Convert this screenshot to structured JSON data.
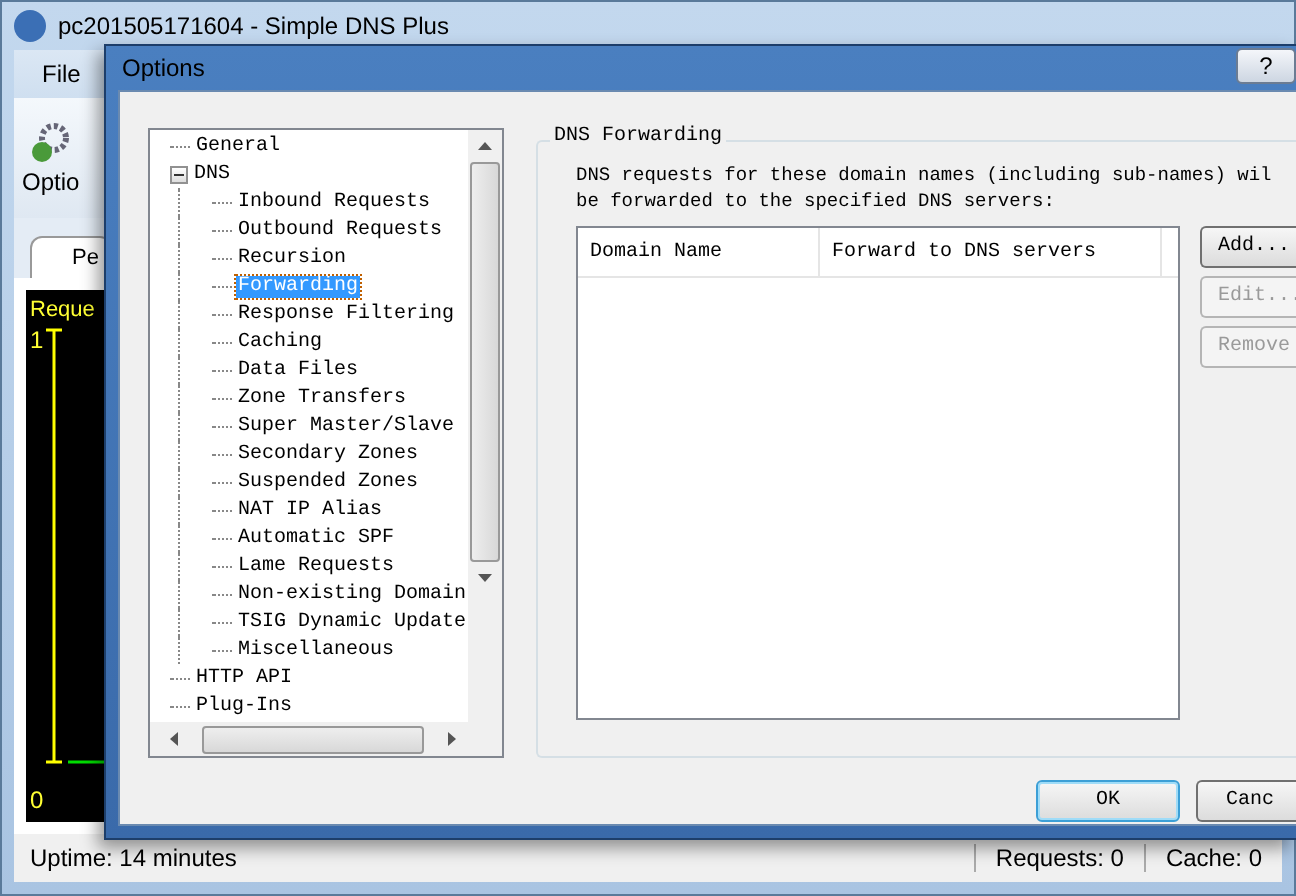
{
  "main_window": {
    "title": "pc201505171604 - Simple DNS Plus",
    "menu": [
      "File"
    ],
    "toolbar": [
      {
        "label": "Optio"
      }
    ],
    "tabs": [
      {
        "label": "Pe",
        "selected": true
      }
    ],
    "graph": {
      "title": "Reque",
      "top_label": "1",
      "bottom_label": "0"
    },
    "status_bar": [
      "Uptime: 14 minutes",
      "Requests: 0",
      "Cache: 0"
    ]
  },
  "dialog": {
    "title": "Options",
    "help_button": "?",
    "tree": [
      {
        "label": "General",
        "selected": false
      },
      {
        "label": "DNS",
        "selected": false,
        "expanded": true,
        "children": [
          {
            "label": "Inbound Requests",
            "selected": false
          },
          {
            "label": "Outbound Requests",
            "selected": false
          },
          {
            "label": "Recursion",
            "selected": false
          },
          {
            "label": "Forwarding",
            "selected": true
          },
          {
            "label": "Response Filtering",
            "selected": false
          },
          {
            "label": "Caching",
            "selected": false
          },
          {
            "label": "Data Files",
            "selected": false
          },
          {
            "label": "Zone Transfers",
            "selected": false
          },
          {
            "label": "Super Master/Slave",
            "selected": false
          },
          {
            "label": "Secondary Zones",
            "selected": false
          },
          {
            "label": "Suspended Zones",
            "selected": false
          },
          {
            "label": "NAT IP Alias",
            "selected": false
          },
          {
            "label": "Automatic SPF",
            "selected": false
          },
          {
            "label": "Lame Requests",
            "selected": false
          },
          {
            "label": "Non-existing Domain",
            "selected": false
          },
          {
            "label": "TSIG Dynamic Update",
            "selected": false
          },
          {
            "label": "Miscellaneous",
            "selected": false
          }
        ]
      },
      {
        "label": "HTTP API",
        "selected": false
      },
      {
        "label": "Plug-Ins",
        "selected": false
      }
    ],
    "group": {
      "title": "DNS Forwarding",
      "description": "DNS requests for these domain names (including sub-names) wil\nbe forwarded to the specified DNS servers:",
      "table": {
        "columns": [
          "Domain Name",
          "Forward to DNS servers"
        ]
      },
      "buttons": [
        {
          "label": "Add...",
          "disabled": false
        },
        {
          "label": "Edit...",
          "disabled": true
        },
        {
          "label": "Remove",
          "disabled": true
        }
      ]
    },
    "footer_buttons": [
      {
        "label": "OK",
        "default": true
      },
      {
        "label": "Canc",
        "default": false
      }
    ]
  }
}
